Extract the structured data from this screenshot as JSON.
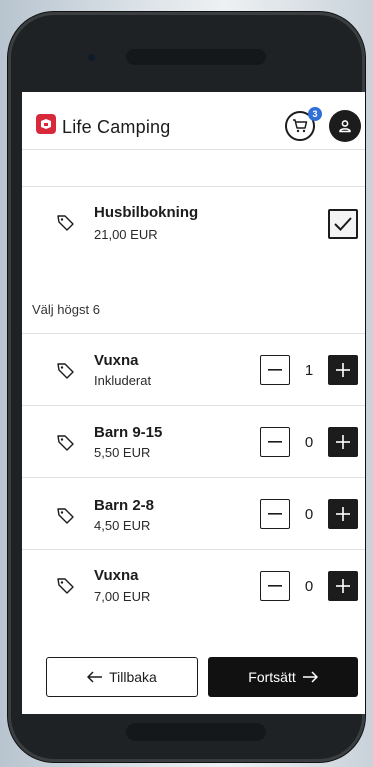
{
  "header": {
    "brand": "Life Camping",
    "cart_count": "3",
    "icons": {
      "logo": "life-camping-logo",
      "cart": "cart-icon",
      "user": "user-icon"
    }
  },
  "booking": {
    "title": "Husbilbokning",
    "price": "21,00 EUR",
    "checked": true
  },
  "choose_label": "Välj högst 6",
  "items": [
    {
      "title": "Vuxna",
      "price": "Inkluderat",
      "qty": "1"
    },
    {
      "title": "Barn 9-15",
      "price": "5,50 EUR",
      "qty": "0"
    },
    {
      "title": "Barn 2-8",
      "price": "4,50 EUR",
      "qty": "0"
    },
    {
      "title": "Vuxna",
      "price": "7,00 EUR",
      "qty": "0"
    }
  ],
  "footer": {
    "back_label": "Tillbaka",
    "next_label": "Fortsätt"
  },
  "colors": {
    "brand_red": "#d7283c",
    "badge_blue": "#2f6fd6",
    "dark": "#1c1c1c"
  }
}
